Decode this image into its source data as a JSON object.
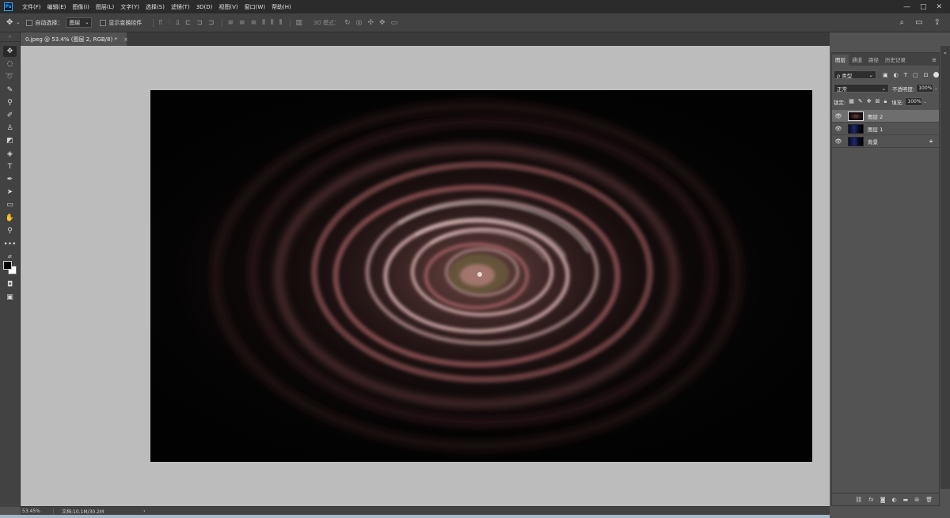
{
  "app": {
    "logo": "Ps",
    "menu": [
      "文件(F)",
      "编辑(E)",
      "图像(I)",
      "图层(L)",
      "文字(Y)",
      "选择(S)",
      "滤镜(T)",
      "3D(D)",
      "视图(V)",
      "窗口(W)",
      "帮助(H)"
    ],
    "window_controls": [
      "—",
      "□",
      "✕"
    ]
  },
  "options": {
    "auto_select_label": "自动选择：",
    "auto_select_value": "图层",
    "show_transform_label": "显示变换控件",
    "mode_label": "3D 模式："
  },
  "document": {
    "tab_title": "0.jpeg @ 53.4% (图层 2, RGB/8) *",
    "tab_close": "×"
  },
  "status": {
    "zoom": "53.45%",
    "doc_info": "文档:10.1M/30.2M",
    "arrow": "›"
  },
  "panels": {
    "tabs": [
      "图层",
      "通道",
      "路径",
      "历史记录"
    ],
    "filter_select": "ρ 类型",
    "blend_mode": "正常",
    "opacity_label": "不透明度:",
    "opacity_value": "100%",
    "lock_label": "锁定:",
    "fill_label": "填充:",
    "fill_value": "100%",
    "layers": [
      {
        "name": "图层 2",
        "selected": true
      },
      {
        "name": "图层 1",
        "selected": false
      },
      {
        "name": "背景",
        "selected": false,
        "locked": true
      }
    ],
    "footer_icons": [
      "link-icon",
      "fx-icon",
      "mask-icon",
      "adjustment-icon",
      "folder-icon",
      "new-layer-icon",
      "trash-icon"
    ]
  },
  "colors": {
    "ring_highlight": "#f2c9c8",
    "ring_mid": "#b86b6e",
    "ring_dark": "#5a2e31",
    "center_green": "#6f6a3c"
  }
}
